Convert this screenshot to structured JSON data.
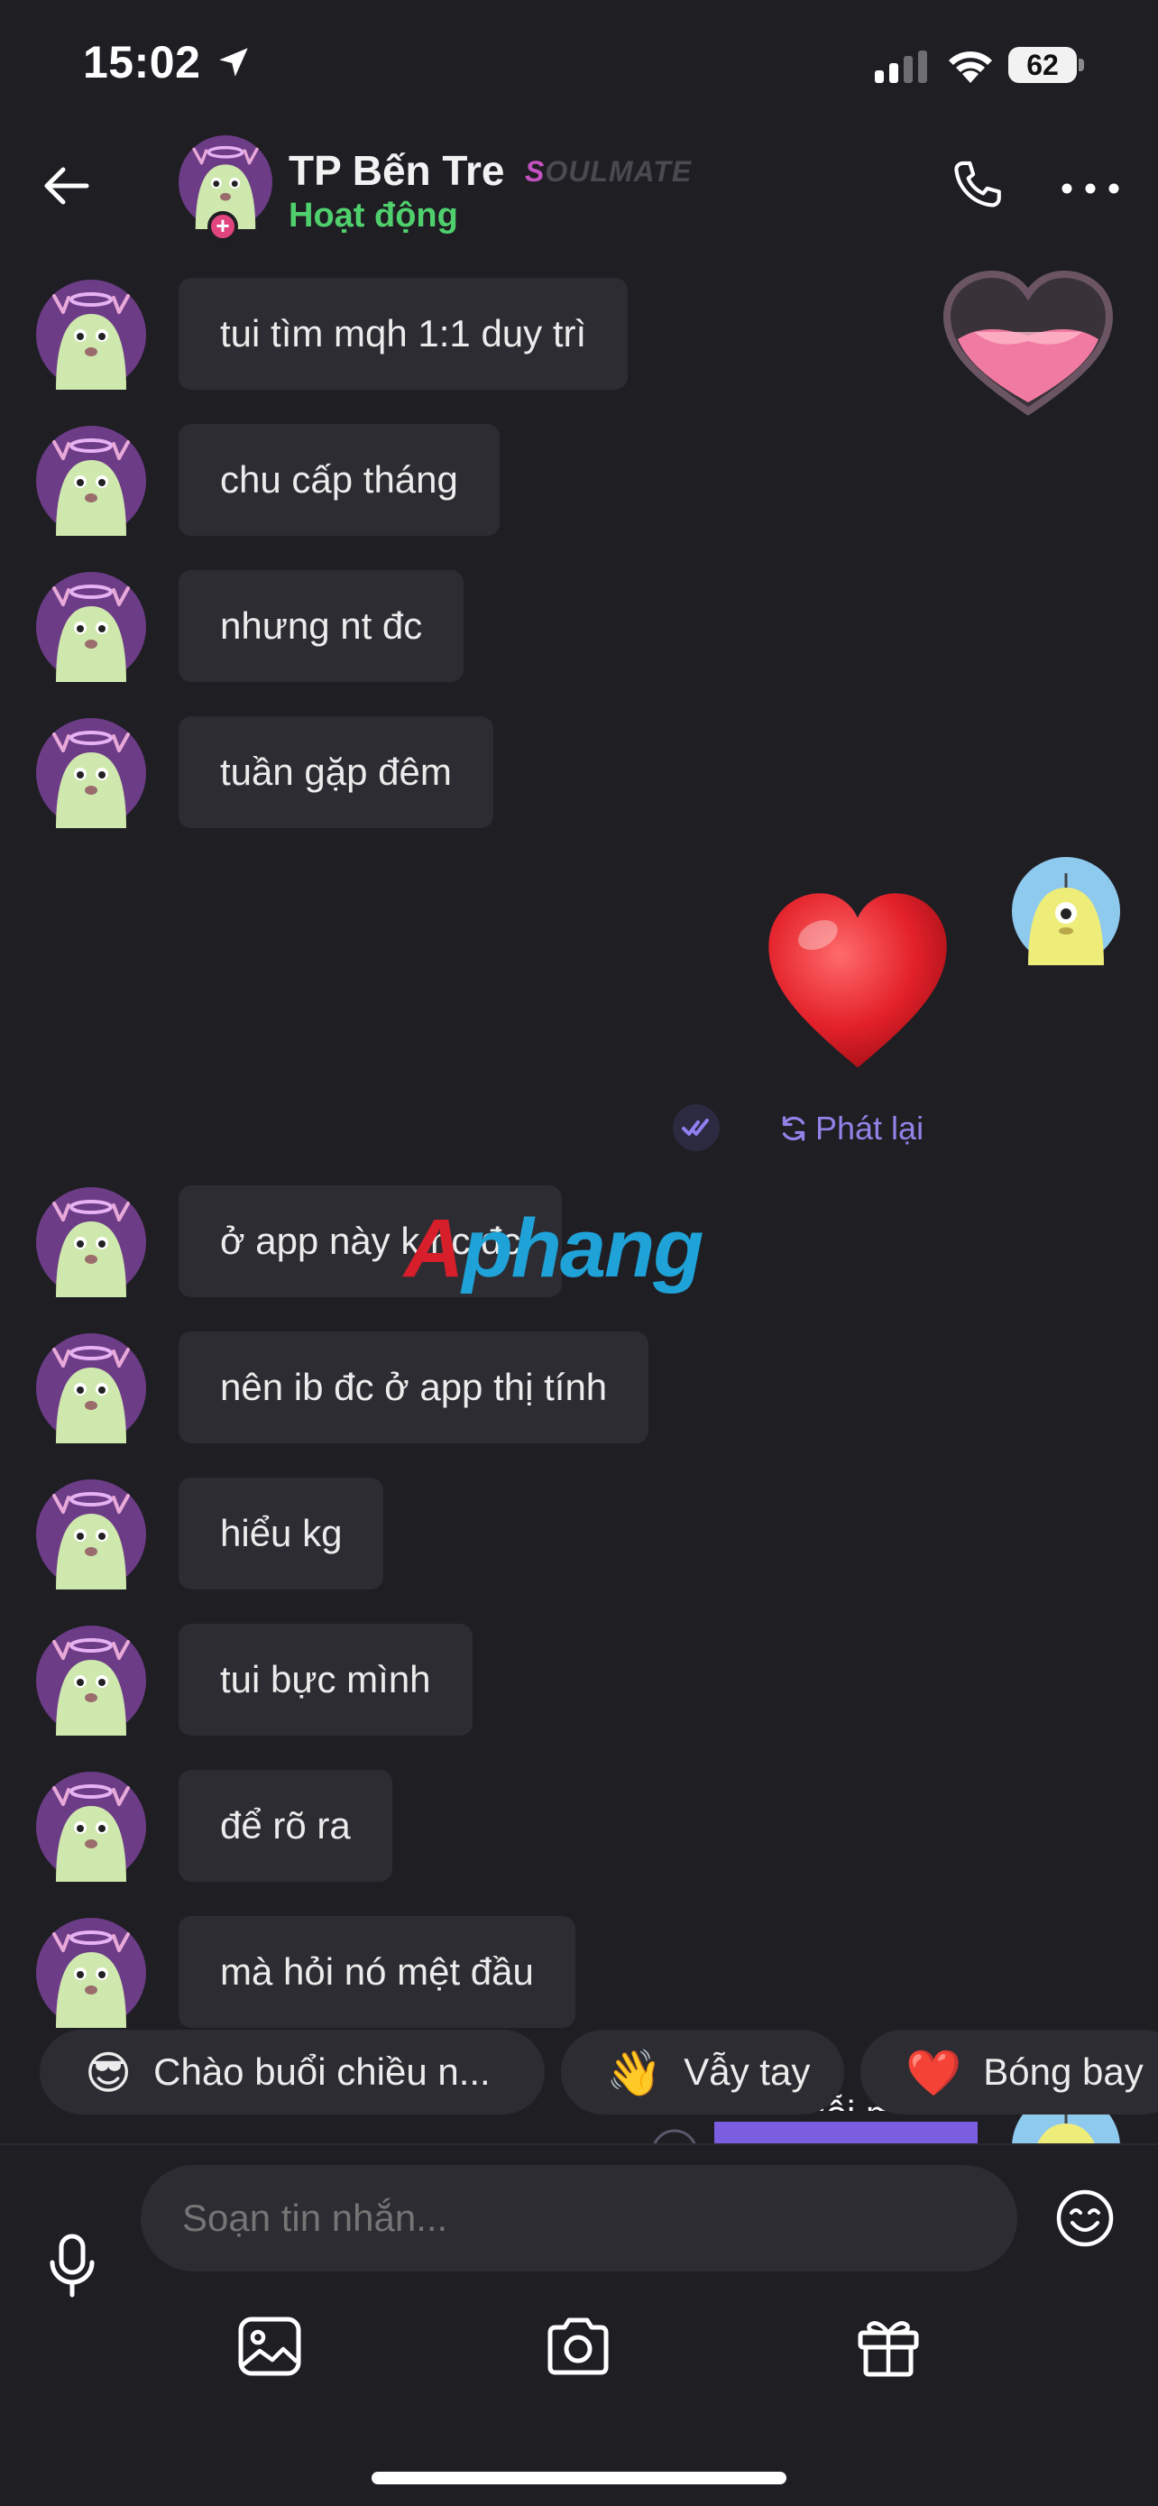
{
  "status_bar": {
    "time": "15:02",
    "battery": "62"
  },
  "header": {
    "contact_name": "TP Bến Tre",
    "badge_first": "S",
    "badge_rest": "OULMATE",
    "status": "Hoạt động"
  },
  "messages_before": [
    "tui tìm mqh 1:1 duy trì",
    "chu cấp tháng",
    "nhưng nt đc",
    "tuần gặp đêm"
  ],
  "replay_label": "Phát lại",
  "watermark": {
    "part1": "A",
    "part2": "phang"
  },
  "messages_after": [
    "ở app này k nc đc",
    "nên ib đc ở app thị tính",
    "hiểu kg",
    "tui bực mình",
    "để rõ ra",
    "mà hỏi nó mệt đầu"
  ],
  "quick_replies": [
    {
      "emoji": "😎",
      "label": "Chào buổi chiều n..."
    },
    {
      "emoji": "👋",
      "label": "Vẫy tay"
    },
    {
      "emoji": "❤️",
      "label": "Bóng bay"
    }
  ],
  "peek_message": "Xin lỗi mà",
  "composer": {
    "placeholder": "Soạn tin nhắn..."
  },
  "colors": {
    "background": "#1f1e23",
    "bubble": "#2d2c32",
    "online": "#4fd06d",
    "accent": "#9482e8",
    "outgoing": "#7b5ee0"
  }
}
